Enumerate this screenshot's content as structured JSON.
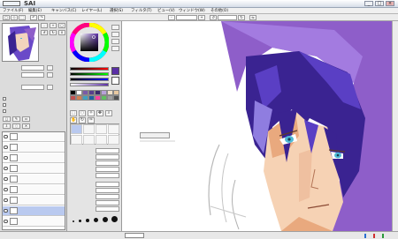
{
  "window": {
    "app_logo": "",
    "app_name": "SAI",
    "doc_title": "",
    "minimize": "_",
    "maximize": "□",
    "close": "×"
  },
  "menu": [
    "ファイル(F)",
    "編集(E)",
    "キャンバス(C)",
    "レイヤー(L)",
    "選択(S)",
    "フィルタ(T)",
    "ビュー(V)",
    "ウィンドウ(W)",
    "その他(O)"
  ],
  "toolbar": {
    "zoom_value": "",
    "angle_value": ""
  },
  "left_panel": {
    "rows": [
      {
        "label": "",
        "value": "",
        "btn": ""
      },
      {
        "label": "",
        "value": "",
        "btn": ""
      },
      {
        "label": "",
        "value": "",
        "btn": ""
      }
    ],
    "checkbox_labels": [
      "",
      "",
      ""
    ]
  },
  "layers": [
    {
      "name": "",
      "mode": ""
    },
    {
      "name": "",
      "mode": ""
    },
    {
      "name": "",
      "mode": ""
    },
    {
      "name": "",
      "mode": ""
    },
    {
      "name": "",
      "mode": ""
    },
    {
      "name": "",
      "mode": ""
    },
    {
      "name": "",
      "mode": ""
    },
    {
      "name": "",
      "mode": ""
    },
    {
      "name": "",
      "mode": ""
    }
  ],
  "tool_panel": {
    "brush_cells": [
      "",
      "",
      "",
      "",
      "",
      "",
      "",
      ""
    ],
    "params": [
      {
        "label": "",
        "value": ""
      },
      {
        "label": "",
        "value": ""
      },
      {
        "label": "",
        "value": ""
      },
      {
        "label": "",
        "value": ""
      },
      {
        "label": "",
        "value": ""
      },
      {
        "label": "",
        "value": ""
      },
      {
        "label": "",
        "value": ""
      },
      {
        "label": "",
        "value": ""
      },
      {
        "label": "",
        "value": ""
      },
      {
        "label": "",
        "value": ""
      }
    ],
    "swatches": [
      "#000000",
      "#ffffff",
      "#7a5aa8",
      "#5a3e8c",
      "#3c2a6a",
      "#b8a0d8",
      "#f0e0c8",
      "#e8c8a0",
      "#c05050",
      "#d08050",
      "#40a0c0",
      "#2060a0",
      "#ff40a0",
      "#60c060",
      "#a0a0a0",
      "#505050"
    ],
    "main_color": "#5b2fa6",
    "sub_color": "#ffffff"
  },
  "canvas": {
    "angle_chip": "",
    "palette": {
      "hair_dark": "#3a2391",
      "hair_mid": "#5a3fc4",
      "hair_light": "#8f7de0",
      "hood": "#8e5ec9",
      "skin": "#f6d2b4",
      "skin_shadow": "#e9a97e",
      "eye": "#4fb9d6",
      "line": "#5d3a2a"
    }
  },
  "status": {
    "text": "",
    "badges": [
      "",
      "",
      ""
    ],
    "zoom": ""
  }
}
